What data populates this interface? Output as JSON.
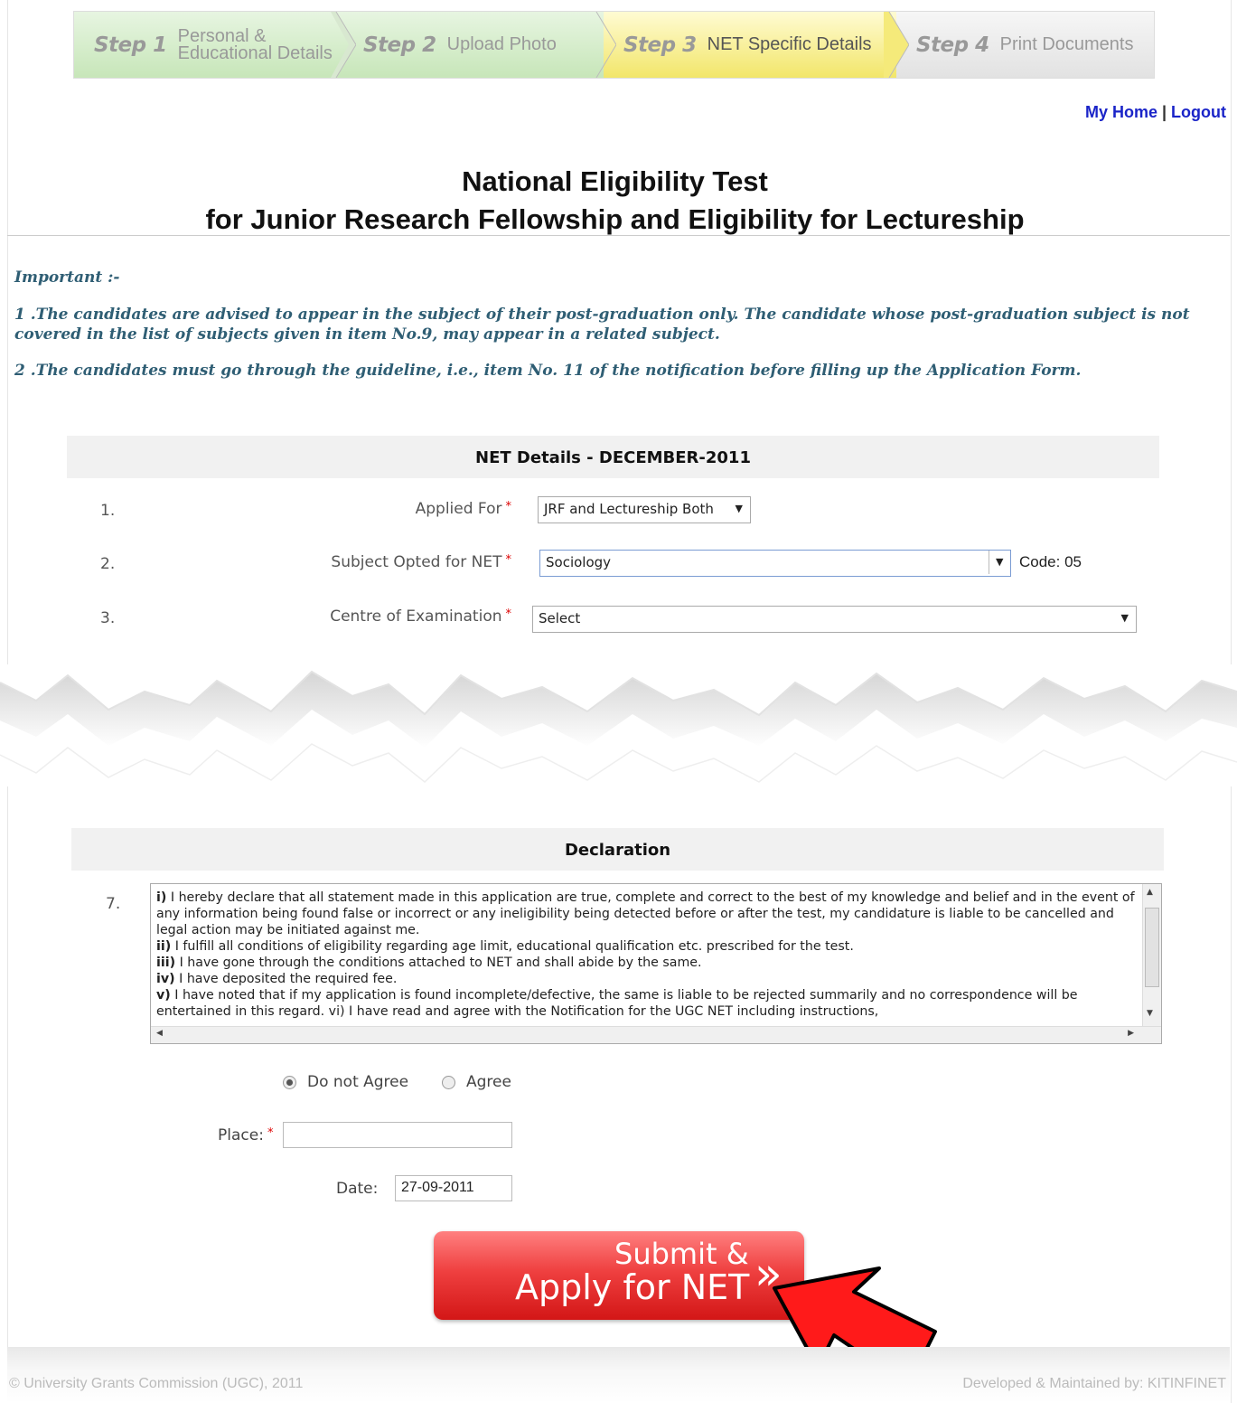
{
  "steps": [
    {
      "num": "Step 1",
      "label_line1": "Personal &",
      "label_line2": "Educational Details"
    },
    {
      "num": "Step 2",
      "label_line1": "Upload Photo",
      "label_line2": ""
    },
    {
      "num": "Step 3",
      "label_line1": "NET Specific Details",
      "label_line2": ""
    },
    {
      "num": "Step 4",
      "label_line1": "Print Documents",
      "label_line2": ""
    }
  ],
  "toplinks": {
    "home": "My Home",
    "sep": " | ",
    "logout": "Logout"
  },
  "title": {
    "line1": "National Eligibility Test",
    "line2": "for Junior Research Fellowship and Eligibility for Lectureship"
  },
  "important": {
    "heading": "Important :-",
    "p1": "1 .The candidates are advised to appear in the subject of their post-graduation only. The candidate whose post-graduation subject is not covered in the list of subjects given in item No.9, may appear in a related subject.",
    "p2": "2 .The candidates must go through the guideline, i.e., item No. 11 of the notification before filling up the Application Form."
  },
  "net_details": {
    "heading": "NET Details - DECEMBER-2011",
    "rows": [
      {
        "num": "1.",
        "label": "Applied For",
        "value": "JRF and Lectureship Both"
      },
      {
        "num": "2.",
        "label": "Subject Opted for NET",
        "value": "Sociology",
        "code": "Code: 05"
      },
      {
        "num": "3.",
        "label": "Centre of Examination",
        "value": "Select"
      }
    ],
    "required_mark": "*"
  },
  "declaration": {
    "heading": "Declaration",
    "num": "7.",
    "items": [
      {
        "b": "i)",
        "t": " I hereby declare that all statement made in this application are true, complete and correct to the best of my knowledge and belief and in the event of any information being found false or incorrect or any ineligibility being detected before or after the test, my candidature is liable to be cancelled and legal action may be initiated against me."
      },
      {
        "b": "ii)",
        "t": " I fulfill all conditions of eligibility regarding age limit, educational qualification etc. prescribed for the test."
      },
      {
        "b": "iii)",
        "t": " I have gone through the conditions attached to NET and shall abide by the same."
      },
      {
        "b": "iv)",
        "t": " I have deposited the required fee."
      },
      {
        "b": "v)",
        "t": " I have noted that if my application is found incomplete/defective, the same is liable to be rejected summarily and no correspondence will be entertained in this regard. vi) I have read and agree with the Notification for the UGC NET including instructions,"
      }
    ],
    "radio_disagree": "Do not Agree",
    "radio_agree": "Agree",
    "selected": "Do not Agree",
    "place_label": "Place:",
    "place_value": "",
    "date_label": "Date:",
    "date_value": "27-09-2011"
  },
  "submit": {
    "line1": "Submit &",
    "line2": "Apply for NET",
    "chevron": "»"
  },
  "footer": {
    "left": "© University Grants Commission (UGC), 2011",
    "right": "Developed & Maintained by: KITINFINET"
  },
  "colors": {
    "link": "#1a24c8",
    "important_text": "#2f5e74",
    "submit": "#e23030",
    "pointer": "#ff1a1a"
  }
}
